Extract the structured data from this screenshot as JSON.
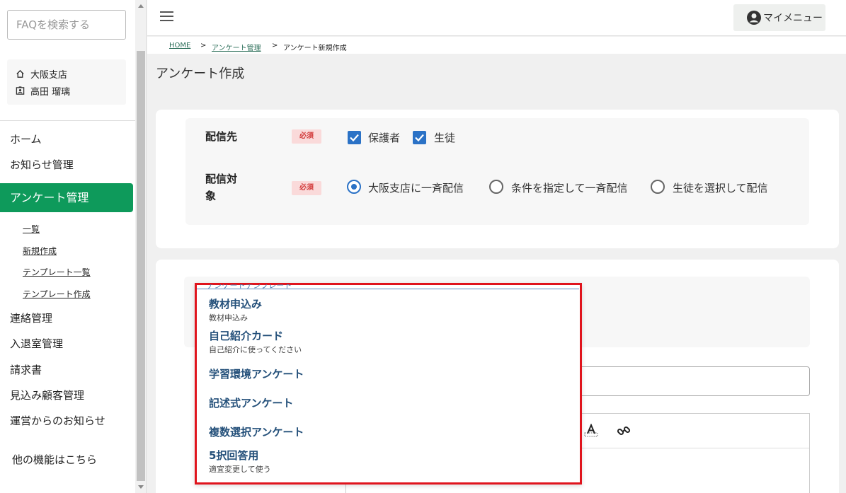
{
  "search": {
    "placeholder": "FAQを検索する"
  },
  "user": {
    "branch": "大阪支店",
    "name": "高田 瑠璃"
  },
  "nav": {
    "home": "ホーム",
    "notices": "お知らせ管理",
    "survey": "アンケート管理",
    "sub": [
      "一覧",
      "新規作成",
      "テンプレート一覧",
      "テンプレート作成"
    ],
    "contact": "連絡管理",
    "attendance": "入退室管理",
    "invoice": "請求書",
    "prospects": "見込み顧客管理",
    "operator_notice": "運営からのお知らせ",
    "other": "他の機能はこちら"
  },
  "header": {
    "my_menu": "マイメニュー"
  },
  "breadcrumb": {
    "home": "HOME",
    "sep1": ">",
    "survey": "アンケート管理",
    "sep2": ">",
    "current": "アンケート新規作成"
  },
  "page_title": "アンケート作成",
  "form": {
    "recipients_label": "配信先",
    "target_label_line1": "配信対",
    "target_label_line2": "象",
    "required": "必須",
    "recipients": [
      {
        "label": "保護者",
        "checked": true
      },
      {
        "label": "生徒",
        "checked": true
      }
    ],
    "targets": [
      {
        "label": "大阪支店に一斉配信",
        "selected": true
      },
      {
        "label": "条件を指定して一斉配信",
        "selected": false
      },
      {
        "label": "生徒を選択して配信",
        "selected": false
      }
    ]
  },
  "template_dropdown": {
    "legend": "アンケートテンプレート",
    "items": [
      {
        "name": "教材申込み",
        "desc": "教材申込み"
      },
      {
        "name": "自己紹介カード",
        "desc": "自己紹介に使ってください"
      },
      {
        "name": "学習環境アンケート",
        "desc": ""
      },
      {
        "name": "記述式アンケート",
        "desc": ""
      },
      {
        "name": "複数選択アンケート",
        "desc": ""
      },
      {
        "name": "5択回答用",
        "desc": "適宜変更して使う"
      }
    ]
  },
  "colors": {
    "accent": "#0e9a5b",
    "checkbox": "#2b72c6",
    "required_bg": "#fadada",
    "highlight_border": "#e0141d"
  }
}
